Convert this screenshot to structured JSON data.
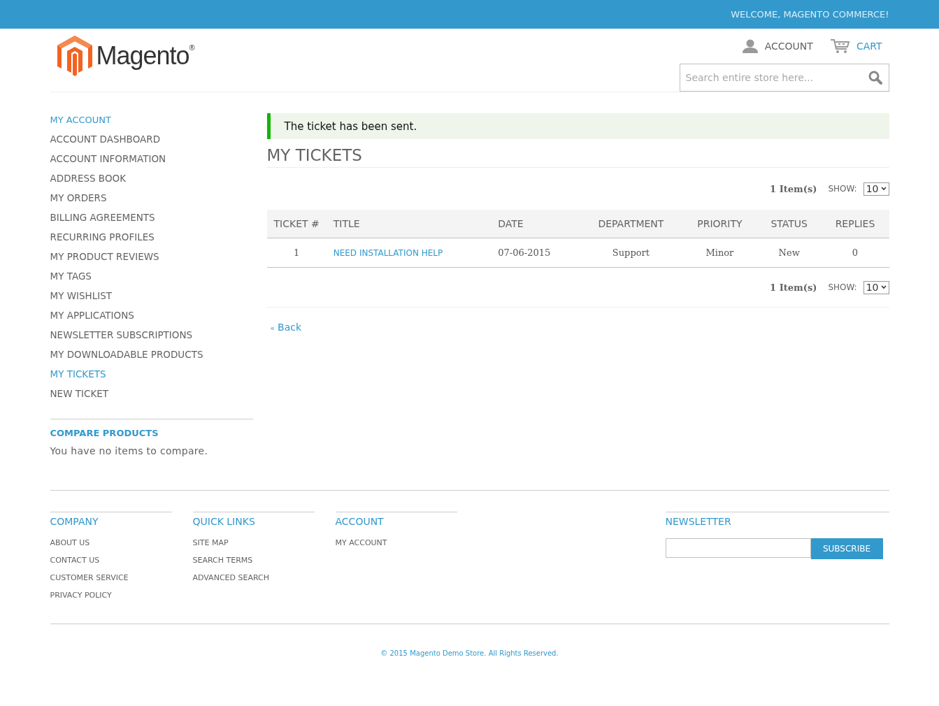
{
  "top_bar": {
    "welcome": "WELCOME, MAGENTO COMMERCE!"
  },
  "header": {
    "logo": "Magento$^{®}$",
    "links": [
      {
        "label": "ACCOUNT",
        "kind": "account",
        "selected": false
      },
      {
        "label": "CART",
        "kind": "cart",
        "selected": true
      }
    ],
    "search": {
      "placeholder": "Search entire store here..."
    }
  },
  "sidebar": {
    "title": "MY ACCOUNT",
    "items": [
      {
        "label": "ACCOUNT DASHBOARD",
        "selected": false
      },
      {
        "label": "ACCOUNT INFORMATION",
        "selected": false
      },
      {
        "label": "ADDRESS BOOK",
        "selected": false
      },
      {
        "label": "MY ORDERS",
        "selected": false
      },
      {
        "label": "BILLING AGREEMENTS",
        "selected": false
      },
      {
        "label": "RECURRING PROFILES",
        "selected": false
      },
      {
        "label": "MY PRODUCT REVIEWS",
        "selected": false
      },
      {
        "label": "MY TAGS",
        "selected": false
      },
      {
        "label": "MY WISHLIST",
        "selected": false
      },
      {
        "label": "MY APPLICATIONS",
        "selected": false
      },
      {
        "label": "NEWSLETTER SUBSCRIPTIONS",
        "selected": false
      },
      {
        "label": "MY DOWNLOADABLE PRODUCTS",
        "selected": false
      },
      {
        "label": "MY TICKETS",
        "selected": true
      },
      {
        "label": "NEW TICKET",
        "selected": false
      }
    ],
    "compare": {
      "title": "COMPARE PRODUCTS",
      "text": "You have no items to compare."
    }
  },
  "message": "The ticket has been sent.",
  "page_title": "MY TICKETS",
  "pager_top": {
    "count": "1 Item(s)",
    "show_label": "SHOW:",
    "show_value": "10"
  },
  "table": {
    "columns": [
      "TICKET #",
      "TITLE",
      "DATE",
      "DEPARTMENT",
      "PRIORITY",
      "STATUS",
      "REPLIES"
    ],
    "rows": [
      {
        "ticket": "1",
        "title": "NEED INSTALLATION HELP",
        "date": "07-06-2015",
        "department": "Support",
        "priority": "Minor",
        "status": "New",
        "replies": "0"
      }
    ]
  },
  "pager_bottom": {
    "count": "1 Item(s)",
    "show_label": "SHOW:",
    "show_value": "10"
  },
  "back_link": {
    "arrow": "«",
    "label": "Back"
  },
  "footer": {
    "columns": [
      {
        "title": "COMPANY",
        "links": [
          "ABOUT US",
          "CONTACT US",
          "CUSTOMER SERVICE",
          "PRIVACY POLICY"
        ]
      },
      {
        "title": "QUICK LINKS",
        "links": [
          "SITE MAP",
          "SEARCH TERMS",
          "ADVANCED SEARCH"
        ]
      },
      {
        "title": "ACCOUNT",
        "links": [
          "MY ACCOUNT"
        ]
      }
    ],
    "newsletter": {
      "title": "NEWSLETTER",
      "button": "SUBSCRIBE"
    },
    "copyright": "© 2015 Magento Demo Store. All Rights Reserved."
  }
}
